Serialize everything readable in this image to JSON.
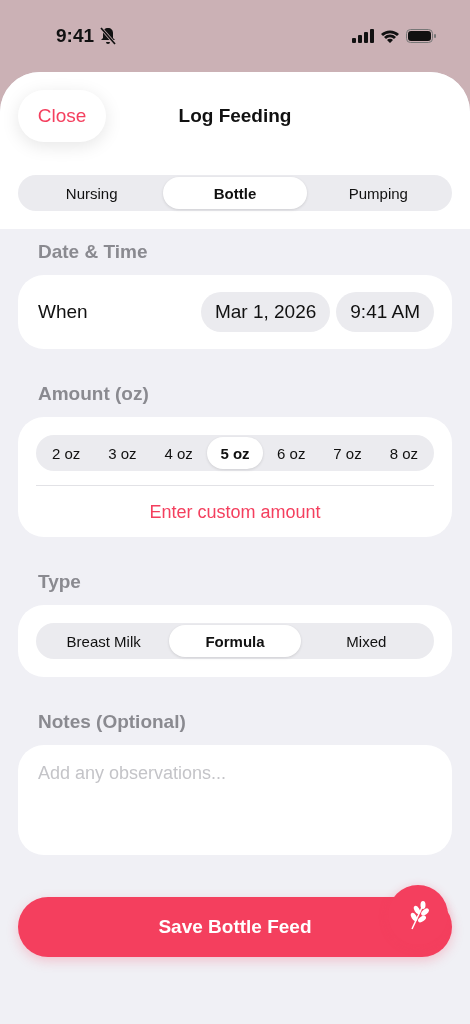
{
  "status_bar": {
    "time": "9:41",
    "silent": true
  },
  "header": {
    "close": "Close",
    "title": "Log Feeding"
  },
  "mode_tabs": [
    {
      "label": "Nursing",
      "selected": false
    },
    {
      "label": "Bottle",
      "selected": true
    },
    {
      "label": "Pumping",
      "selected": false
    }
  ],
  "date_time": {
    "heading": "Date & Time",
    "label": "When",
    "date": "Mar 1, 2026",
    "time": "9:41 AM"
  },
  "amount": {
    "heading": "Amount (oz)",
    "options": [
      {
        "label": "2 oz",
        "selected": false
      },
      {
        "label": "3 oz",
        "selected": false
      },
      {
        "label": "4 oz",
        "selected": false
      },
      {
        "label": "5 oz",
        "selected": true
      },
      {
        "label": "6 oz",
        "selected": false
      },
      {
        "label": "7 oz",
        "selected": false
      },
      {
        "label": "8 oz",
        "selected": false
      }
    ],
    "custom": "Enter custom amount"
  },
  "type": {
    "heading": "Type",
    "options": [
      {
        "label": "Breast Milk",
        "selected": false
      },
      {
        "label": "Formula",
        "selected": true
      },
      {
        "label": "Mixed",
        "selected": false
      }
    ]
  },
  "notes": {
    "heading": "Notes (Optional)",
    "placeholder": "Add any observations..."
  },
  "save_button": "Save Bottle Feed"
}
